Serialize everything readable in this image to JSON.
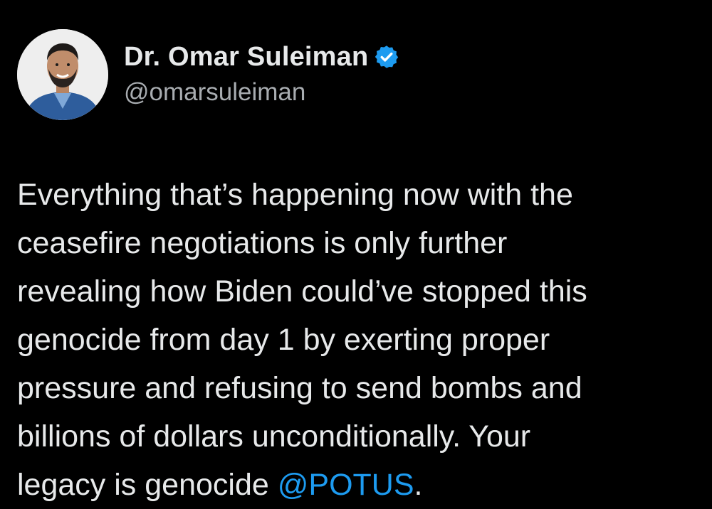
{
  "author": {
    "display_name": "Dr. Omar Suleiman",
    "handle": "@omarsuleiman",
    "verified": true,
    "avatar_icon": "profile-photo-icon",
    "verified_icon": "verified-badge-icon"
  },
  "tweet": {
    "lines": [
      "Everything that’s happening now with the",
      "ceasefire negotiations is only further",
      "revealing how Biden could’ve stopped this",
      "genocide from day 1 by exerting proper",
      "pressure and refusing to send bombs and",
      "billions of dollars unconditionally. Your"
    ],
    "last_line_prefix": "legacy is genocide ",
    "mention": "@POTUS",
    "last_line_suffix": "."
  },
  "colors": {
    "background": "#000000",
    "text": "#e7e9ea",
    "handle": "#a8acb0",
    "mention": "#1d9bf0",
    "verified": "#1d9bf0"
  }
}
